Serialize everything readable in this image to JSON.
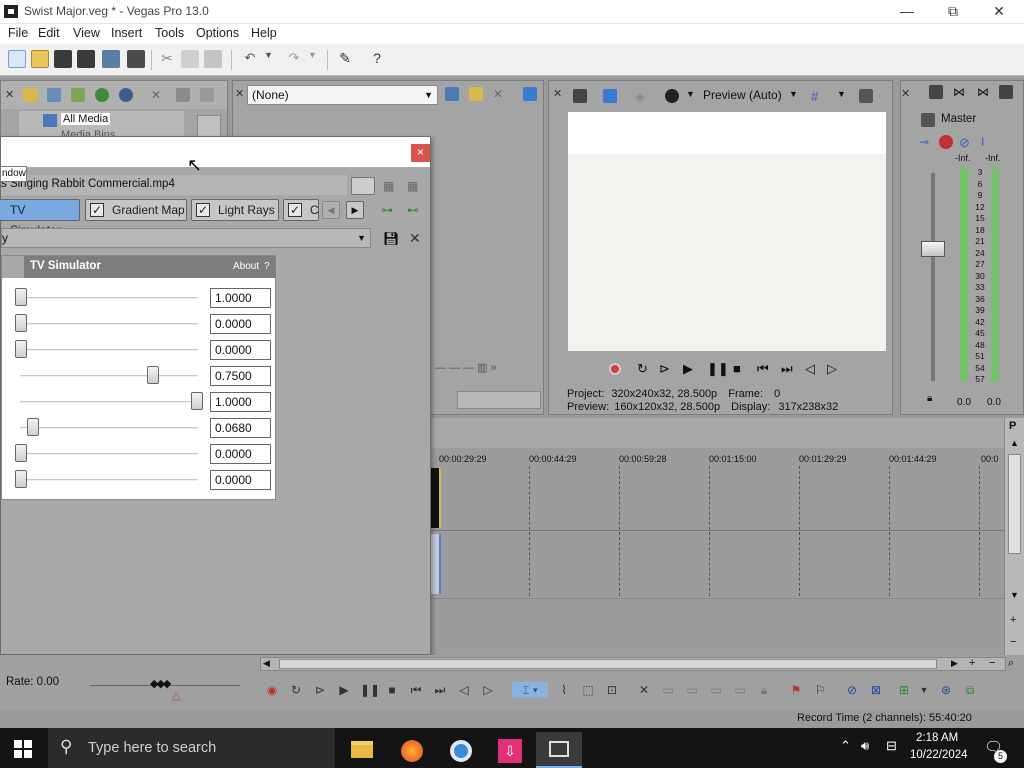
{
  "window": {
    "title": "Swist Major.veg * - Vegas Pro 13.0",
    "minimize": "—",
    "maximize": "⧉",
    "close": "✕"
  },
  "menu": [
    "File",
    "Edit",
    "View",
    "Insert",
    "Tools",
    "Options",
    "Help"
  ],
  "explorer": {
    "item1": "All Media",
    "item2": "Media Bins"
  },
  "transitions": {
    "dropdown_value": "(None)"
  },
  "preview": {
    "mode": "Preview (Auto)",
    "project_label": "Project:",
    "project_value": "320x240x32, 28.500p",
    "preview_label": "Preview:",
    "preview_value": "160x120x32, 28.500p",
    "frame_label": "Frame:",
    "frame_value": "0",
    "display_label": "Display:",
    "display_value": "317x238x32"
  },
  "master": {
    "title": "Master",
    "inf_left": "-Inf.",
    "inf_right": "-Inf.",
    "scale": [
      "3",
      "6",
      "9",
      "12",
      "15",
      "18",
      "21",
      "24",
      "27",
      "30",
      "33",
      "36",
      "39",
      "42",
      "45",
      "48",
      "51",
      "54",
      "57"
    ],
    "val_left": "0.0",
    "val_right": "0.0"
  },
  "fx_dialog": {
    "tooltip": "ndow",
    "source": "s Singing Rabbit Commercial.mp4",
    "chain": [
      "TV Simulator",
      "Gradient Map",
      "Light Rays",
      "C"
    ],
    "preset": "y",
    "plugin_title": "TV Simulator",
    "about": "About",
    "help": "?",
    "sliders": [
      {
        "value": "1.0000",
        "level": 0.0
      },
      {
        "value": "0.0000",
        "level": 0.0
      },
      {
        "value": "0.0000",
        "level": 0.0
      },
      {
        "value": "0.7500",
        "level": 0.75
      },
      {
        "value": "1.0000",
        "level": 1.0
      },
      {
        "value": "0.0680",
        "level": 0.068
      },
      {
        "value": "0.0000",
        "level": 0.0
      },
      {
        "value": "0.0000",
        "level": 0.0
      }
    ]
  },
  "timeline": {
    "ticks": [
      "00:00:29:29",
      "00:00:44:29",
      "00:00:59:28",
      "00:01:15:00",
      "00:01:29:29",
      "00:01:44:29",
      "00:0"
    ]
  },
  "transport": {
    "rate": "Rate: 0.00"
  },
  "status": {
    "record_time": "Record Time (2 channels): 55:40:20"
  },
  "taskbar": {
    "search_placeholder": "Type here to search",
    "time": "2:18 AM",
    "date": "10/22/2024",
    "notif_count": "5"
  },
  "colors": {
    "accent_blue": "#2b7bd6",
    "close_red": "#d9534f",
    "meter_green": "#74c26a"
  }
}
